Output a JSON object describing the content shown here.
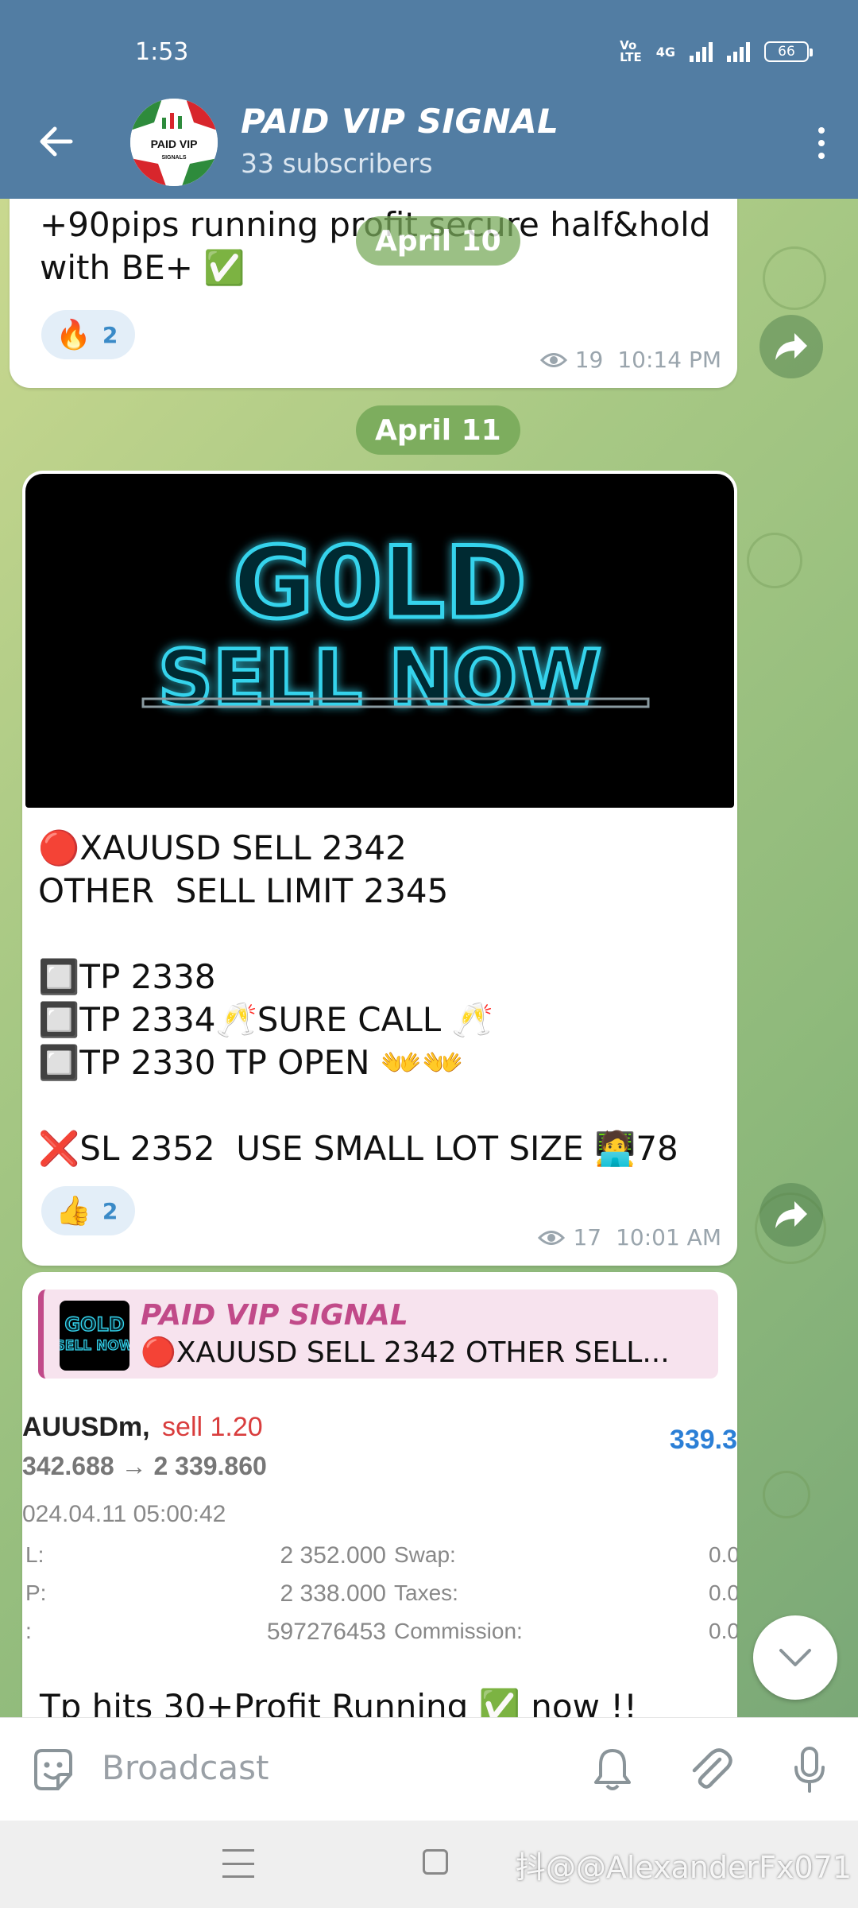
{
  "status_bar": {
    "time": "1:53",
    "network": "4G",
    "battery": "66"
  },
  "header": {
    "title": "PAID VIP SIGNAL",
    "subtitle": "33 subscribers",
    "avatar_text": "PAID VIP",
    "avatar_subtext": "SIGNALS"
  },
  "date_pills": [
    "April 10",
    "April 11"
  ],
  "messages": [
    {
      "text": "+90pips running profit secure half&hold\nwith BE+ ✅",
      "reaction_emoji": "🔥",
      "reaction_count": "2",
      "views": "19",
      "time": "10:14 PM"
    },
    {
      "image_line1": "G0LD",
      "image_line2": "SELL NOW",
      "text": "🔴XAUUSD SELL 2342\nOTHER  SELL LIMIT 2345\n\n🔲TP 2338\n🔲TP 2334🥂SURE CALL 🥂\n🔲TP 2330 TP OPEN 👐👐\n\n❌SL 2352  USE SMALL LOT SIZE 🧑‍💻78",
      "reaction_emoji": "👍",
      "reaction_count": "2",
      "views": "17",
      "time": "10:01 AM"
    },
    {
      "reply_title": "PAID VIP SIGNAL",
      "reply_text": "🔴XAUUSD SELL 2342 OTHER  SELL...",
      "reply_thumb_line1": "GOLD",
      "reply_thumb_line2": "SELL NOW",
      "trade": {
        "symbol": "AUUSDm,",
        "side": "sell 1.20",
        "profit": "339.3",
        "prices": "342.688 → 2 339.860",
        "datetime": "024.04.11 05:00:42",
        "rows": [
          {
            "k1": "L:",
            "v1": "2 352.000",
            "k2": "Swap:",
            "v2": "0.0"
          },
          {
            "k1": "P:",
            "v1": "2 338.000",
            "k2": "Taxes:",
            "v2": "0.0"
          },
          {
            "k1": ":",
            "v1": "597276453",
            "k2": "Commission:",
            "v2": "0.0"
          }
        ]
      },
      "text": "Tp hits 30+Profit Running ✅ now !!"
    }
  ],
  "composer": {
    "placeholder": "Broadcast"
  },
  "watermark": "抖@@AlexanderFx071",
  "colors": {
    "header": "#527da3",
    "accent_pink": "#c14a89",
    "link_blue": "#3a8ac7",
    "trade_red": "#d93d3d",
    "trade_blue": "#2b7fd6"
  },
  "icons": [
    "back-arrow-icon",
    "more-vert-icon",
    "share-icon",
    "eye-icon",
    "sticker-icon",
    "bell-icon",
    "attach-icon",
    "mic-icon",
    "chevron-down-icon"
  ]
}
